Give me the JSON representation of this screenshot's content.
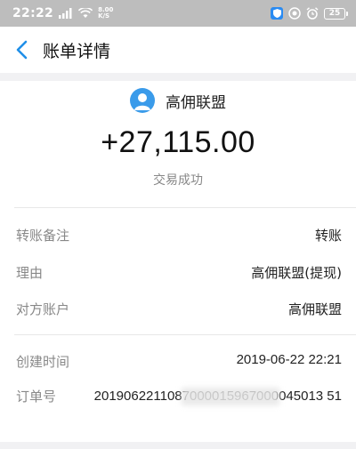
{
  "status_bar": {
    "time": "22:22",
    "net_speed_top": "8.00",
    "net_speed_bottom": "K/S",
    "battery": "25"
  },
  "nav": {
    "title": "账单详情"
  },
  "summary": {
    "payee": "高佣联盟",
    "amount": "+27,115.00",
    "status": "交易成功"
  },
  "details": {
    "remark_label": "转账备注",
    "remark_value": "转账",
    "reason_label": "理由",
    "reason_value": "高佣联盟(提现)",
    "account_label": "对方账户",
    "account_value": "高佣联盟",
    "created_label": "创建时间",
    "created_value": "2019-06-22 22:21",
    "order_label": "订单号",
    "order_value": "2019062211087000015967000045013 51"
  },
  "colors": {
    "accent": "#1f8fe8",
    "status_bar_bg": "#bdbdbd",
    "label_gray": "#888888"
  }
}
